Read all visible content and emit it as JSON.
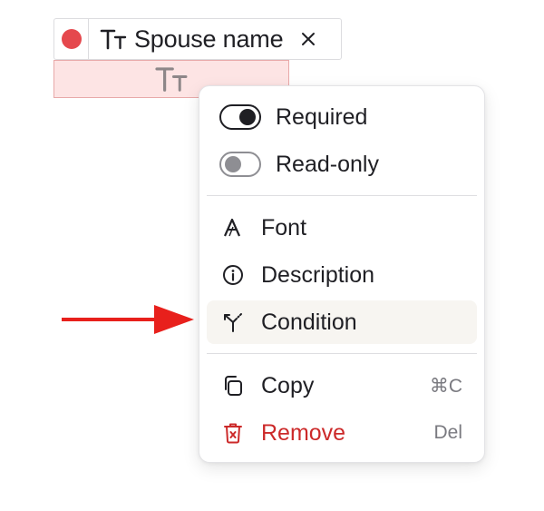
{
  "field": {
    "name": "Spouse name",
    "color": "#e5484d",
    "type_icon": "text-type-icon"
  },
  "menu": {
    "toggles": [
      {
        "label": "Required",
        "state": "on"
      },
      {
        "label": "Read-only",
        "state": "off"
      }
    ],
    "items": [
      {
        "label": "Font",
        "icon": "font-icon",
        "shortcut": ""
      },
      {
        "label": "Description",
        "icon": "info-icon",
        "shortcut": ""
      },
      {
        "label": "Condition",
        "icon": "condition-icon",
        "shortcut": "",
        "highlighted": true
      },
      {
        "label": "Copy",
        "icon": "copy-icon",
        "shortcut": "⌘C"
      },
      {
        "label": "Remove",
        "icon": "trash-icon",
        "shortcut": "Del",
        "danger": true
      }
    ]
  },
  "colors": {
    "danger": "#cc2a2a",
    "arrow": "#e8201c",
    "field_fill": "#fde4e4",
    "hover": "#f7f5f1"
  }
}
